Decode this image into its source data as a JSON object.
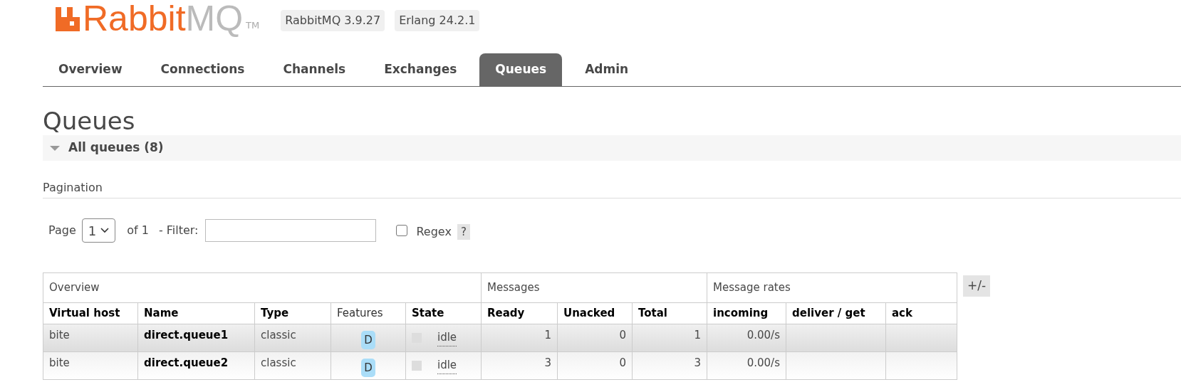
{
  "header": {
    "logo": {
      "brand": "Rabbit",
      "suffix": "MQ",
      "tm": "TM"
    },
    "badges": [
      "RabbitMQ 3.9.27",
      "Erlang 24.2.1"
    ]
  },
  "tabs": [
    {
      "label": "Overview",
      "selected": false
    },
    {
      "label": "Connections",
      "selected": false
    },
    {
      "label": "Channels",
      "selected": false
    },
    {
      "label": "Exchanges",
      "selected": false
    },
    {
      "label": "Queues",
      "selected": true
    },
    {
      "label": "Admin",
      "selected": false
    }
  ],
  "title": "Queues",
  "section": {
    "label": "All queues (8)",
    "expanded": true
  },
  "pagination": {
    "label": "Pagination",
    "page_label": "Page",
    "page": "1",
    "of": "of 1",
    "filter_label": "- Filter:",
    "regex": {
      "label": "Regex",
      "checked": false
    },
    "help": "?"
  },
  "table": {
    "groups": [
      "Overview",
      "Messages",
      "Message rates"
    ],
    "columns": [
      "Virtual host",
      "Name",
      "Type",
      "Features",
      "State",
      "Ready",
      "Unacked",
      "Total",
      "incoming",
      "deliver / get",
      "ack"
    ],
    "rows": [
      {
        "highlighted": true,
        "vhost": "bite",
        "name": "direct.queue1",
        "type": "classic",
        "feature": "D",
        "state": "idle",
        "ready": "1",
        "unacked": "0",
        "total": "1",
        "incoming": "0.00/s"
      },
      {
        "highlighted": false,
        "vhost": "bite",
        "name": "direct.queue2",
        "type": "classic",
        "feature": "D",
        "state": "idle",
        "ready": "3",
        "unacked": "0",
        "total": "3",
        "incoming": "0.00/s"
      }
    ],
    "toggle": "+/-"
  }
}
